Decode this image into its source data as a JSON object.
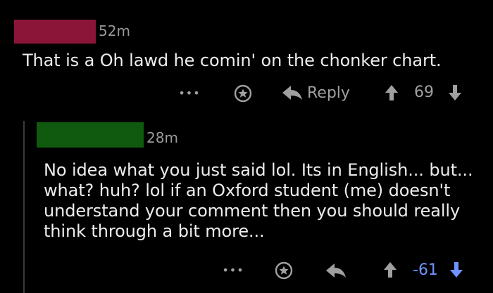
{
  "comment1": {
    "username_redaction_color": "#8a1538",
    "time": "52m",
    "text": "That is a Oh lawd he comin' on the chonker chart.",
    "actions": {
      "more": "•••",
      "award": "award-icon",
      "reply_label": "Reply",
      "upvote": "upvote-icon",
      "score": "69",
      "downvote": "downvote-icon"
    }
  },
  "comment2": {
    "username_redaction_color": "#0f5a0f",
    "time": "28m",
    "text": "No idea what you just said lol. Its in English... but... what? huh? lol if an Oxford student (me) doesn't understand your comment then you should really think through a bit more...",
    "actions": {
      "more": "•••",
      "award": "award-icon",
      "reply": "reply-icon",
      "upvote": "upvote-icon",
      "score": "-61",
      "score_color": "#7193ff",
      "downvote_color": "#7193ff",
      "downvote": "downvote-icon"
    }
  }
}
